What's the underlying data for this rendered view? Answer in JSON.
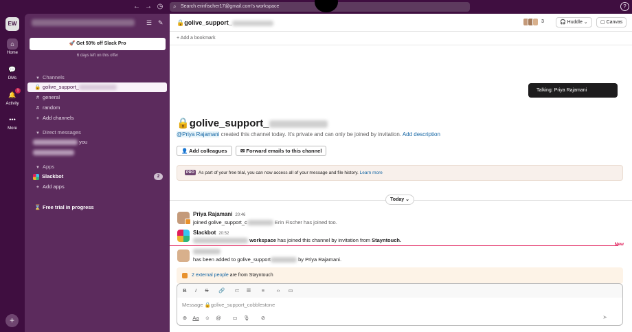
{
  "topbar": {
    "search_placeholder": "Search erinfischer17@gmail.com's workspace"
  },
  "rail": {
    "workspace_initials": "EW",
    "items": [
      {
        "label": "Home",
        "icon": "home-icon"
      },
      {
        "label": "DMs",
        "icon": "dms-icon"
      },
      {
        "label": "Activity",
        "icon": "bell-icon",
        "badge": "1"
      },
      {
        "label": "More",
        "icon": "more-icon"
      }
    ]
  },
  "sidebar": {
    "promo_label": "Get 50% off Slack Pro",
    "promo_sub": "6 days left on this offer",
    "channels_header": "Channels",
    "channels": [
      {
        "name": "golive_support_",
        "icon": "lock-icon"
      },
      {
        "name": "general",
        "icon": "hash-icon"
      },
      {
        "name": "random",
        "icon": "hash-icon"
      }
    ],
    "add_channels": "Add channels",
    "dm_header": "Direct messages",
    "dm_suffix": "you",
    "apps_header": "Apps",
    "slackbot": "Slackbot",
    "slackbot_badge": "2",
    "add_apps": "Add apps",
    "trial": "Free trial in progress"
  },
  "channel": {
    "name": "golive_support_",
    "member_count": "3",
    "huddle_label": "Huddle",
    "canvas_label": "Canvas",
    "add_bookmark": "Add a bookmark",
    "tooltip": "Talking: Priya Rajamani",
    "intro_mention": "@Priya Rajamani",
    "intro_text": " created this channel today. It's private and can only be joined by invitation.",
    "intro_link": "Add description",
    "add_colleagues": "Add colleagues",
    "forward_emails": "Forward emails to this channel",
    "pro_tag": "PRO",
    "pro_text": "As part of your free trial, you can now access all of your message and file history.",
    "pro_link": "Learn more",
    "today": "Today"
  },
  "messages": [
    {
      "author": "Priya Rajamani",
      "time": "20:46",
      "text_a": "joined golive_support_c",
      "text_b": "Erin Fischer has joined too."
    },
    {
      "author": "Slackbot",
      "time": "20:52",
      "text_a": "workspace",
      "text_b": "has joined this channel by invitation from",
      "text_c": "Stayntouch."
    },
    {
      "text_a": "has been added to golive_support",
      "text_b": "by Priya Rajamani."
    }
  ],
  "new_label": "New",
  "external_banner": {
    "link": "2 external people",
    "text": " are from Stayntouch"
  },
  "composer": {
    "placeholder": "Message 🔒golive_support_cobblestone"
  },
  "colors": {
    "aubergine": "#3f0e40",
    "sidebar": "#5c2b5d",
    "link": "#1264a3",
    "new": "#e01e5a"
  }
}
